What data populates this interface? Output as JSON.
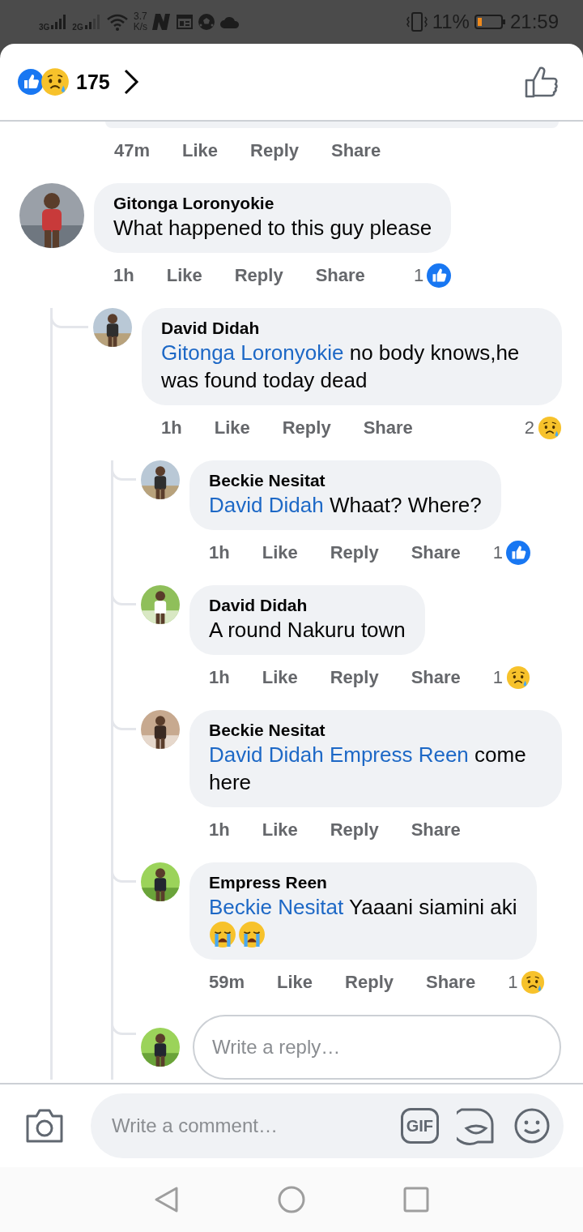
{
  "status_bar": {
    "network_1": "3G",
    "network_2": "2G",
    "speed_value": "3.7",
    "speed_unit": "K/s",
    "battery": "11%",
    "time": "21:59"
  },
  "header": {
    "reaction_count": "175"
  },
  "top_actions": {
    "time": "47m",
    "like": "Like",
    "reply": "Reply",
    "share": "Share"
  },
  "comments": [
    {
      "author": "Gitonga Loronyokie",
      "text": "What happened to this guy please",
      "actions": {
        "time": "1h",
        "like": "Like",
        "reply": "Reply",
        "share": "Share"
      },
      "reaction": {
        "count": "1",
        "kind": "like"
      },
      "children": [
        {
          "author": "David Didah",
          "mentions": [
            "Gitonga Loronyokie"
          ],
          "text": "no body knows,he was found today dead",
          "actions": {
            "time": "1h",
            "like": "Like",
            "reply": "Reply",
            "share": "Share"
          },
          "reaction": {
            "count": "2",
            "kind": "sad"
          },
          "reply_placeholder": "Write a reply…",
          "children": [
            {
              "author": "Beckie Nesitat",
              "mentions": [
                "David Didah"
              ],
              "text": "Whaat? Where?",
              "actions": {
                "time": "1h",
                "like": "Like",
                "reply": "Reply",
                "share": "Share"
              },
              "reaction": {
                "count": "1",
                "kind": "like"
              }
            },
            {
              "author": "David Didah",
              "text": "A round Nakuru town",
              "actions": {
                "time": "1h",
                "like": "Like",
                "reply": "Reply",
                "share": "Share"
              },
              "reaction": {
                "count": "1",
                "kind": "sad"
              }
            },
            {
              "author": "Beckie Nesitat",
              "mentions": [
                "David Didah",
                "Empress Reen"
              ],
              "text": "come here",
              "actions": {
                "time": "1h",
                "like": "Like",
                "reply": "Reply",
                "share": "Share"
              }
            },
            {
              "author": "Empress Reen",
              "mentions": [
                "Beckie Nesitat"
              ],
              "text": "Yaaani siamini aki",
              "emojis": [
                {
                  "kind": "crying"
                },
                {
                  "kind": "crying"
                }
              ],
              "actions": {
                "time": "59m",
                "like": "Like",
                "reply": "Reply",
                "share": "Share"
              },
              "reaction": {
                "count": "1",
                "kind": "sad"
              }
            }
          ]
        }
      ]
    }
  ],
  "composer": {
    "placeholder": "Write a comment…",
    "gif": "GIF"
  }
}
